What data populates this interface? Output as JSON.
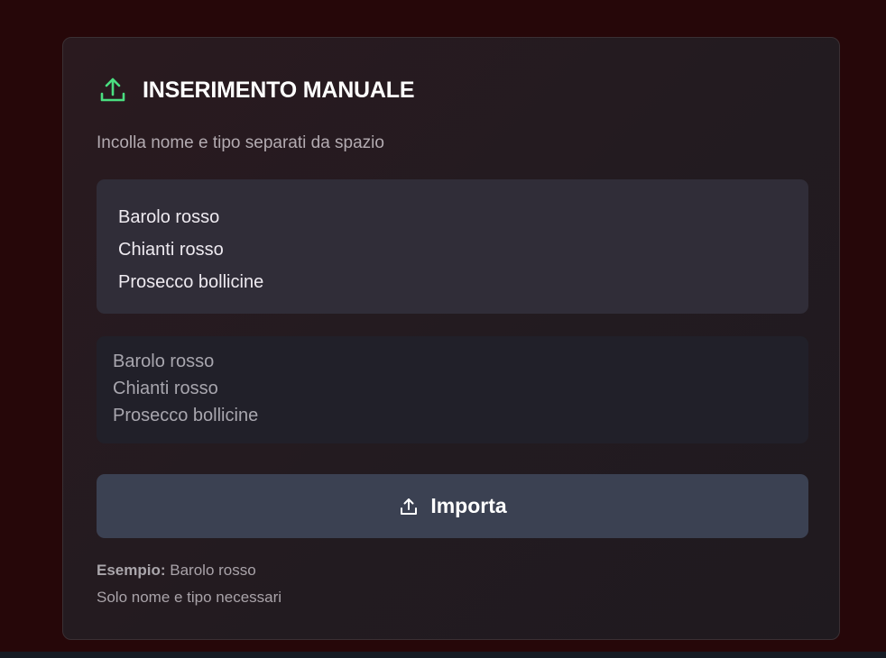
{
  "header": {
    "icon": "upload-icon",
    "title": "INSERIMENTO MANUALE"
  },
  "subtitle": "Incolla nome e tipo separati da spazio",
  "preview": {
    "lines": [
      "Barolo rosso",
      "Chianti rosso",
      "Prosecco bollicine"
    ]
  },
  "input": {
    "lines": [
      "Barolo rosso",
      "Chianti rosso",
      "Prosecco bollicine"
    ]
  },
  "import_button": {
    "icon": "upload-icon",
    "label": "Importa"
  },
  "footer": {
    "example_label": "Esempio:",
    "example_value": "Barolo rosso",
    "note": "Solo nome e tipo necessari"
  },
  "colors": {
    "background": "#260709",
    "accent_icon": "#4ade80",
    "button": "#3b4152"
  }
}
